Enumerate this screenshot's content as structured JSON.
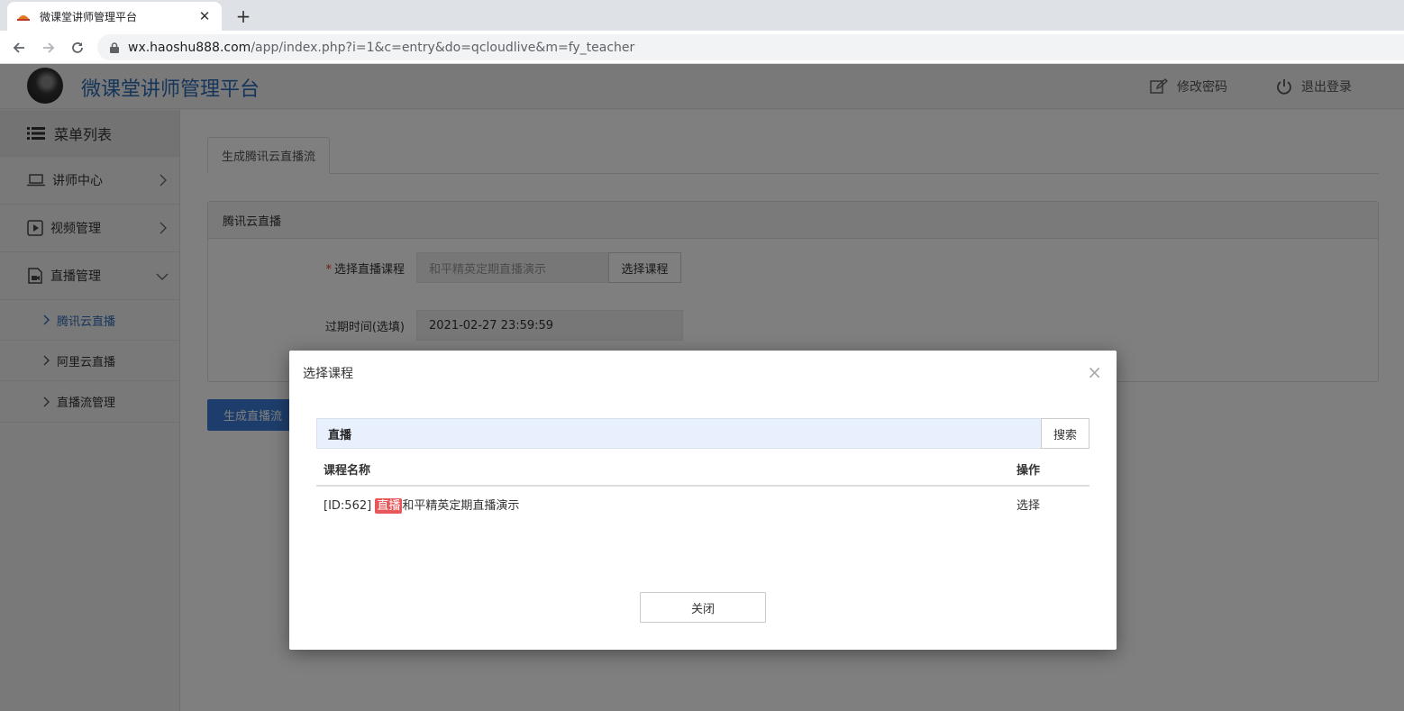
{
  "browser": {
    "tab_title": "微课堂讲师管理平台",
    "tab_close": "✕",
    "new_tab": "+",
    "url_host": "wx.haoshu888.com",
    "url_path": "/app/index.php?i=1&c=entry&do=qcloudlive&m=fy_teacher"
  },
  "header": {
    "brand": "微课堂讲师管理平台",
    "change_password": "修改密码",
    "logout": "退出登录"
  },
  "sidebar": {
    "menu_title": "菜单列表",
    "items": [
      {
        "label": "讲师中心",
        "icon": "laptop-icon"
      },
      {
        "label": "视频管理",
        "icon": "play-icon"
      },
      {
        "label": "直播管理",
        "icon": "live-icon"
      }
    ],
    "sub_items": [
      {
        "label": "腾讯云直播",
        "active": true
      },
      {
        "label": "阿里云直播",
        "active": false
      },
      {
        "label": "直播流管理",
        "active": false
      }
    ]
  },
  "main": {
    "tab": "生成腾讯云直播流",
    "panel_title": "腾讯云直播",
    "course_label_required": "*",
    "course_label": "选择直播课程",
    "course_value": "和平精英定期直播演示",
    "choose_course_btn": "选择课程",
    "expire_label": "过期时间(选填)",
    "expire_value": "2021-02-27 23:59:59",
    "generate_btn": "生成直播流"
  },
  "modal": {
    "title": "选择课程",
    "close_x": "×",
    "search_value": "直播",
    "search_btn": "搜索",
    "col_name": "课程名称",
    "col_op": "操作",
    "rows": [
      {
        "prefix": "[ID:562] ",
        "highlight": "直播",
        "suffix": "和平精英定期直播演示",
        "action": "选择"
      }
    ],
    "close_btn": "关闭"
  },
  "colors": {
    "brand": "#2d6bb6",
    "primary": "#3b7dd8",
    "highlight": "#e8585a"
  }
}
